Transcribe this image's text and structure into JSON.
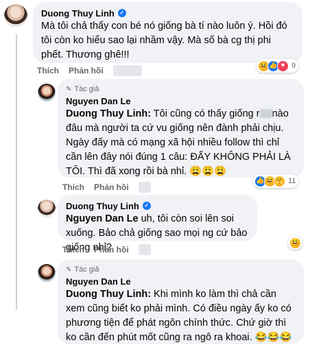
{
  "comments": [
    {
      "author": "Duong Thuy Linh",
      "text": "Mà tôi chả thấy con bé nó giống bà tí nào luôn ý. Hồi đó tôi còn ko hiểu sao lại nhầm vậy. Mà số bà cg thị phi phết. Thương ghê!!!",
      "like_label": "Thích",
      "reply_label": "Phản hồi",
      "reaction_count": "9",
      "reaction_icons": [
        "haha-reaction-icon",
        "like-reaction-icon",
        "love-reaction-icon"
      ]
    },
    {
      "author": "Nguyen Dan Le",
      "author_badge": "Tác giả",
      "mention": "Duong Thuy Linh:",
      "text_a": " Tôi cũng có thấy giống r",
      "text_b": "nào đâu mà người ta cứ vu giống nên đành phải chịu. Ngày đấy mà có mạng xã hội nhiều follow thì chỉ cần lên đây nói đúng 1 câu: ĐẤY KHÔNG PHẢI LÀ TÔI. Thì đã xong rồi bà nhỉ. 😩😩😩",
      "like_label": "Thích",
      "reply_label": "Phản hồi",
      "reaction_count": "11",
      "reaction_icons": [
        "like-reaction-icon",
        "haha-reaction-icon",
        "care-reaction-icon"
      ]
    },
    {
      "author": "Duong Thuy Linh",
      "mention": "Nguyen Dan Le",
      "text": " uh, tôi còn soi lên soi xuống. Bảo chả giống sao mọi ng cứ bảo giống nhỉ?",
      "like_label": "Thích",
      "reply_label": "Phản hồi",
      "reaction_icons": [
        "haha-reaction-icon"
      ]
    },
    {
      "author": "Nguyen Dan Le",
      "author_badge": "Tác giả",
      "mention": "Duong Thuy Linh:",
      "text": " Khi mình ko làm thì chả cần xem cũng biết ko phải mình. Có điều ngày ấy ko có phương tiện để phát ngôn chính thức. Chứ giờ thì ko cần đến phút mốt cũng ra ngô ra khoai. 😂😂😂"
    }
  ],
  "colors": {
    "bubble": "#f0f2f5",
    "verified": "#1877f2",
    "meta_text": "#65676b"
  }
}
